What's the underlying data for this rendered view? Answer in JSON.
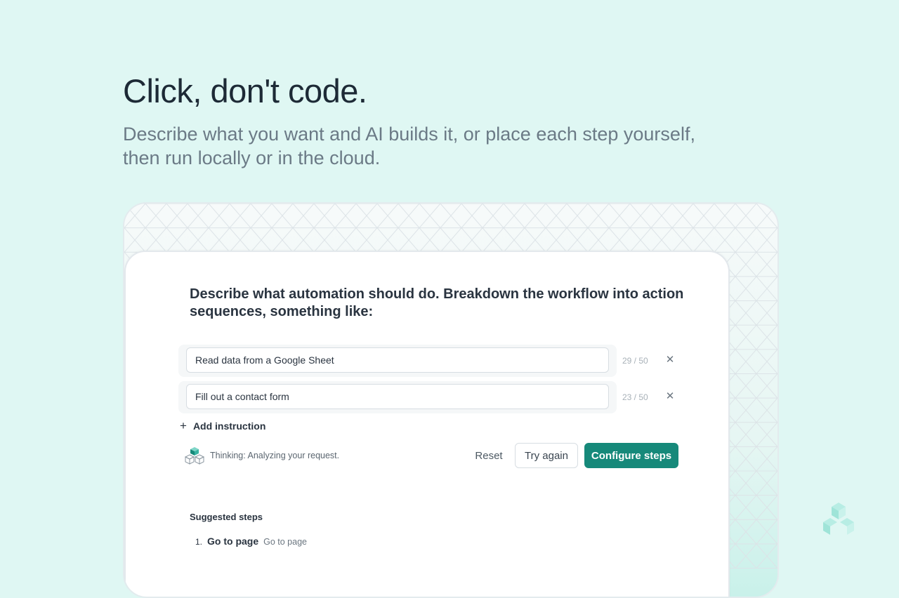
{
  "hero": {
    "headline": "Click, don't code.",
    "subline_line1": "Describe what you want and AI builds it, or place each step yourself,",
    "subline_line2": "then run locally or in the cloud."
  },
  "card": {
    "title": "Describe what automation should do. Breakdown the workflow into action sequences, something like:",
    "instructions": [
      {
        "value": "Read data from a Google Sheet",
        "counter": "29 / 50",
        "remove_icon": "close-icon"
      },
      {
        "value": "Fill out a contact form",
        "counter": "23 / 50",
        "remove_icon": "close-icon"
      }
    ],
    "add_instruction_label": "Add instruction",
    "thinking_text": "Thinking: Analyzing your request.",
    "buttons": {
      "reset": "Reset",
      "try_again": "Try again",
      "configure_steps": "Configure steps"
    },
    "suggested_title": "Suggested steps",
    "suggested_steps": [
      {
        "number": "1.",
        "name": "Go to page",
        "description": "Go to page"
      }
    ]
  },
  "colors": {
    "background": "#dff7f3",
    "accent": "#16897a",
    "headline": "#1d2a36",
    "subtext": "#6b7a86"
  }
}
